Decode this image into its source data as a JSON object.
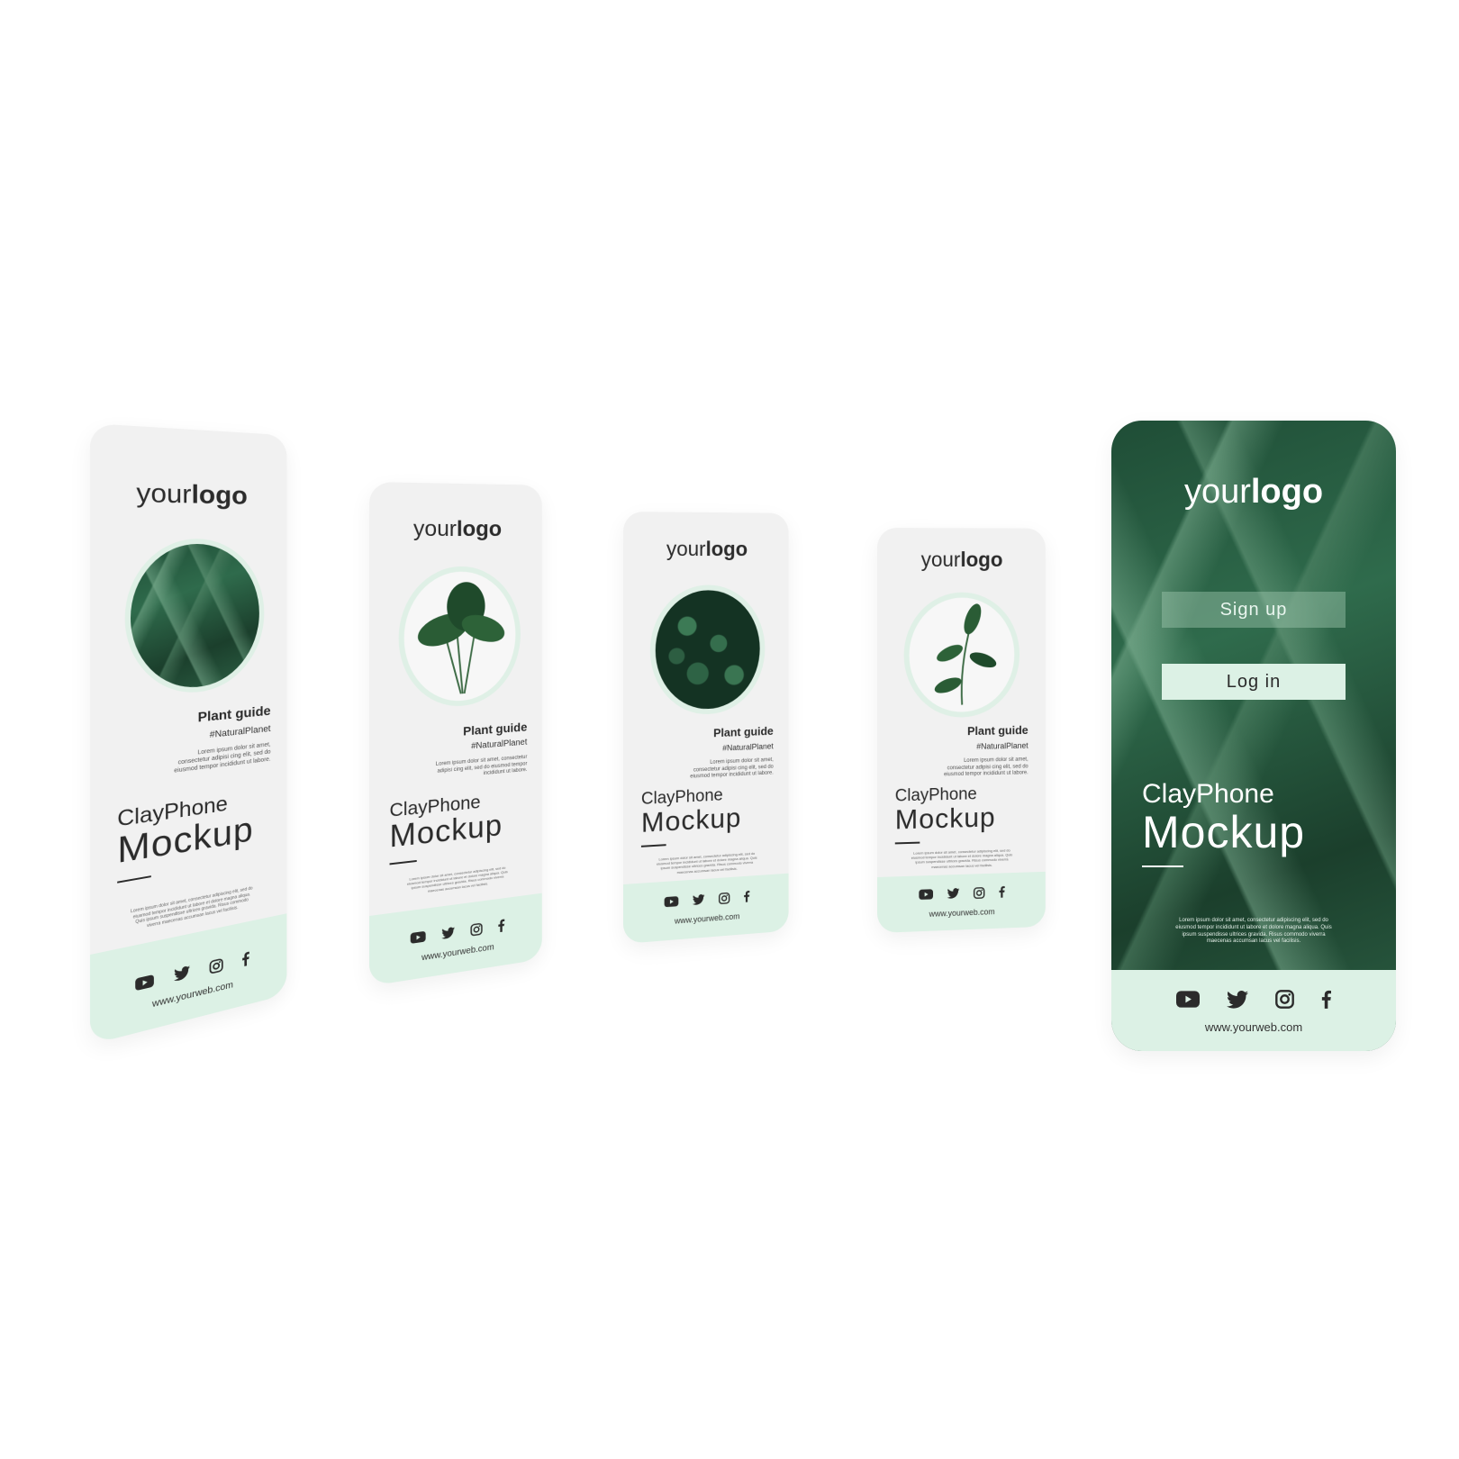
{
  "logo": {
    "light": "your",
    "bold": "logo"
  },
  "card": {
    "title": "Plant guide",
    "hashtag": "#NaturalPlanet",
    "lorem": "Lorem ipsum dolor sit amet, consectetur adipisi cing elit, sed do eiusmod tempor incididunt ut labore.",
    "body_lorem": "Lorem ipsum dolor sit amet, consectetur adipiscing elit, sed do eiusmod tempor incididunt ut labore et dolore magna aliqua. Quis ipsum suspendisse ultrices gravida. Risus commodo viverra maecenas accumsan lacus vel facilisis."
  },
  "brand": {
    "line1": "ClayPhone",
    "line2": "Mockup"
  },
  "buttons": {
    "signup": "Sign up",
    "login": "Log in"
  },
  "footer": {
    "website": "www.yourweb.com"
  },
  "icons": [
    "youtube-icon",
    "twitter-icon",
    "instagram-icon",
    "facebook-icon"
  ],
  "colors": {
    "mint": "#dcf1e5",
    "dark_text": "#2b2b2b",
    "leaf_green": "#2f6b4c"
  }
}
